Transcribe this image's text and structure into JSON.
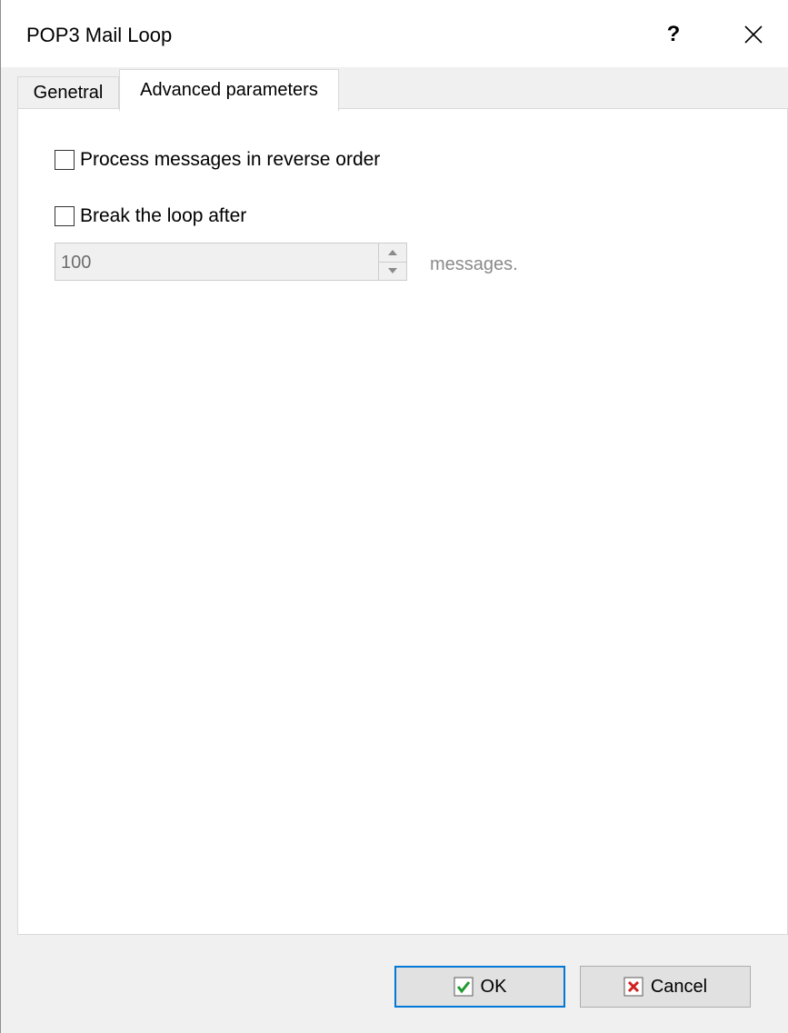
{
  "window": {
    "title": "POP3 Mail Loop",
    "help_glyph": "?"
  },
  "tabs": [
    {
      "label": "Genetral",
      "active": false
    },
    {
      "label": "Advanced parameters",
      "active": true
    }
  ],
  "advanced": {
    "reverse_order_label": "Process messages in reverse order",
    "reverse_order_checked": false,
    "break_loop_label": "Break the loop after",
    "break_loop_checked": false,
    "count_value": "100",
    "count_units": "messages."
  },
  "buttons": {
    "ok_label": "OK",
    "cancel_label": "Cancel"
  },
  "icons": {
    "help": "question-mark-icon",
    "close": "close-icon",
    "spin_up": "triangle-up-icon",
    "spin_down": "triangle-down-icon",
    "ok": "green-check-icon",
    "cancel": "red-x-icon"
  },
  "colors": {
    "ok_check": "#1f9a2f",
    "cancel_x": "#d21f1f",
    "default_button_border": "#0078d7"
  }
}
